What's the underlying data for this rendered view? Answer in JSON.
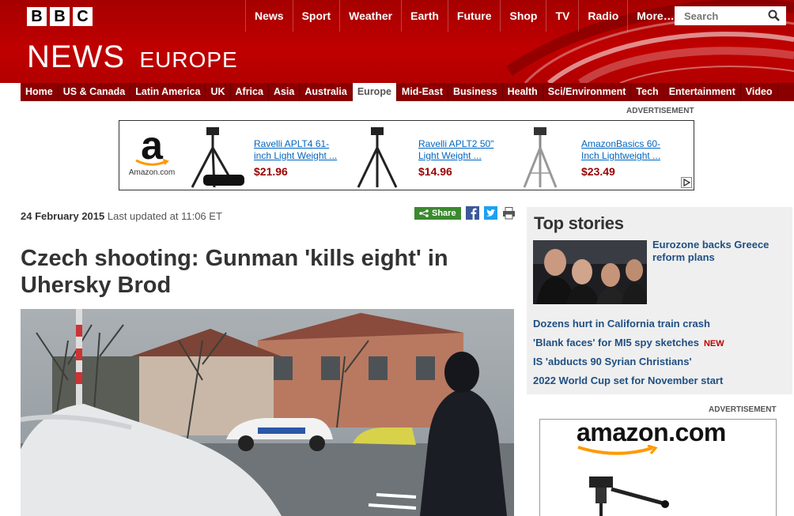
{
  "header": {
    "logo_letters": [
      "B",
      "B",
      "C"
    ],
    "nav": [
      "News",
      "Sport",
      "Weather",
      "Earth",
      "Future",
      "Shop",
      "TV",
      "Radio",
      "More…"
    ],
    "search_placeholder": "Search",
    "brand": "NEWS",
    "section": "EUROPE",
    "brand_color": "#bb0000"
  },
  "subnav": {
    "items": [
      "Home",
      "US & Canada",
      "Latin America",
      "UK",
      "Africa",
      "Asia",
      "Australia",
      "Europe",
      "Mid-East",
      "Business",
      "Health",
      "Sci/Environment",
      "Tech",
      "Entertainment",
      "Video"
    ],
    "active": "Europe"
  },
  "ad_top": {
    "label": "ADVERTISEMENT",
    "logo_letter": "a",
    "logo_caption": "Amazon.com",
    "products": [
      {
        "name": "Ravelli APLT4 61-inch Light Weight ...",
        "price": "$21.96",
        "icon": "tripod-with-bag"
      },
      {
        "name": "Ravelli APLT2 50\" Light Weight ...",
        "price": "$14.96",
        "icon": "tripod-black"
      },
      {
        "name": "AmazonBasics 60-Inch Lightweight ...",
        "price": "$23.49",
        "icon": "tripod-silver"
      }
    ]
  },
  "article": {
    "date": "24 February 2015",
    "updated": "Last updated at 11:06 ET",
    "share_label": "Share",
    "headline": "Czech shooting: Gunman 'kills eight' in Uhersky Brod"
  },
  "top_stories": {
    "title": "Top stories",
    "main": "Eurozone backs Greece reform plans",
    "items": [
      {
        "text": "Dozens hurt in California train crash",
        "badge": ""
      },
      {
        "text": "'Blank faces' for MI5 spy sketches",
        "badge": "NEW"
      },
      {
        "text": "IS 'abducts 90 Syrian Christians'",
        "badge": ""
      },
      {
        "text": "2022 World Cup set for November start",
        "badge": ""
      }
    ]
  },
  "ad_side": {
    "label": "ADVERTISEMENT",
    "wordmark": "amazon.com"
  }
}
